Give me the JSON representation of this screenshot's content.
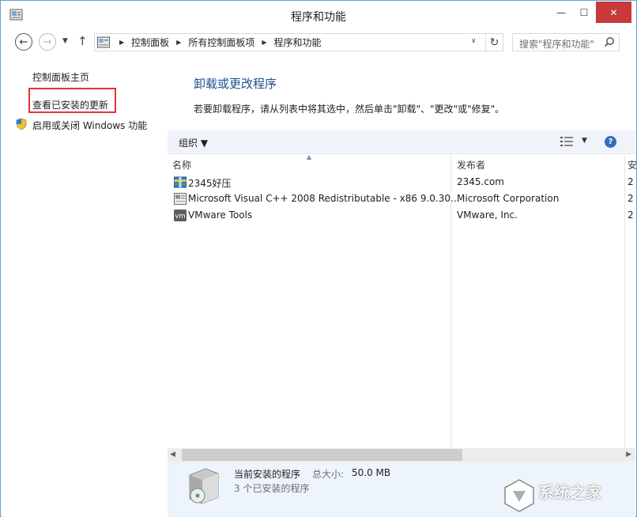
{
  "window": {
    "title": "程序和功能",
    "min_glyph": "—",
    "max_glyph": "☐",
    "close_glyph": "✕"
  },
  "nav": {
    "back_glyph": "←",
    "fwd_glyph": "→",
    "recent_glyph": "▼",
    "up_glyph": "↑",
    "breadcrumbs": [
      "控制面板",
      "所有控制面板项",
      "程序和功能"
    ],
    "crumb_sep": "▶",
    "drop_glyph": "∨",
    "refresh_glyph": "↻",
    "search_placeholder": "搜索\"程序和功能\""
  },
  "left": {
    "home": "控制面板主页",
    "updates": "查看已安装的更新",
    "features": "启用或关闭 Windows 功能"
  },
  "main": {
    "heading": "卸载或更改程序",
    "description": "若要卸载程序，请从列表中将其选中，然后单击\"卸载\"、\"更改\"或\"修复\"。"
  },
  "toolbar": {
    "organize": "组织 ▼",
    "views_drop": "▼",
    "help": "?"
  },
  "list": {
    "columns": {
      "name": "名称",
      "publisher": "发布者",
      "cut": "安"
    },
    "sort_glyph": "▲",
    "rows": [
      {
        "name": "2345好压",
        "publisher": "2345.com",
        "cut": "2",
        "icon": "archive-icon"
      },
      {
        "name": "Microsoft Visual C++ 2008 Redistributable - x86 9.0.30...",
        "publisher": "Microsoft Corporation",
        "cut": "2",
        "icon": "installer-icon"
      },
      {
        "name": "VMware Tools",
        "publisher": "VMware, Inc.",
        "cut": "2",
        "icon": "vmware-icon"
      }
    ]
  },
  "scrollbar": {
    "left_glyph": "◀",
    "right_glyph": "▶"
  },
  "details": {
    "title": "当前安装的程序",
    "size_label": "总大小:",
    "size_value": "50.0 MB",
    "count": "3 个已安装的程序"
  },
  "watermark": {
    "text": "系统之家"
  },
  "colors": {
    "frame": "#5aa3da",
    "close": "#c8393a",
    "heading": "#1e4e8c",
    "highlight": "#e43336",
    "toolbar_bg": "#f0f3f9",
    "details_bg": "#eef4fb"
  }
}
